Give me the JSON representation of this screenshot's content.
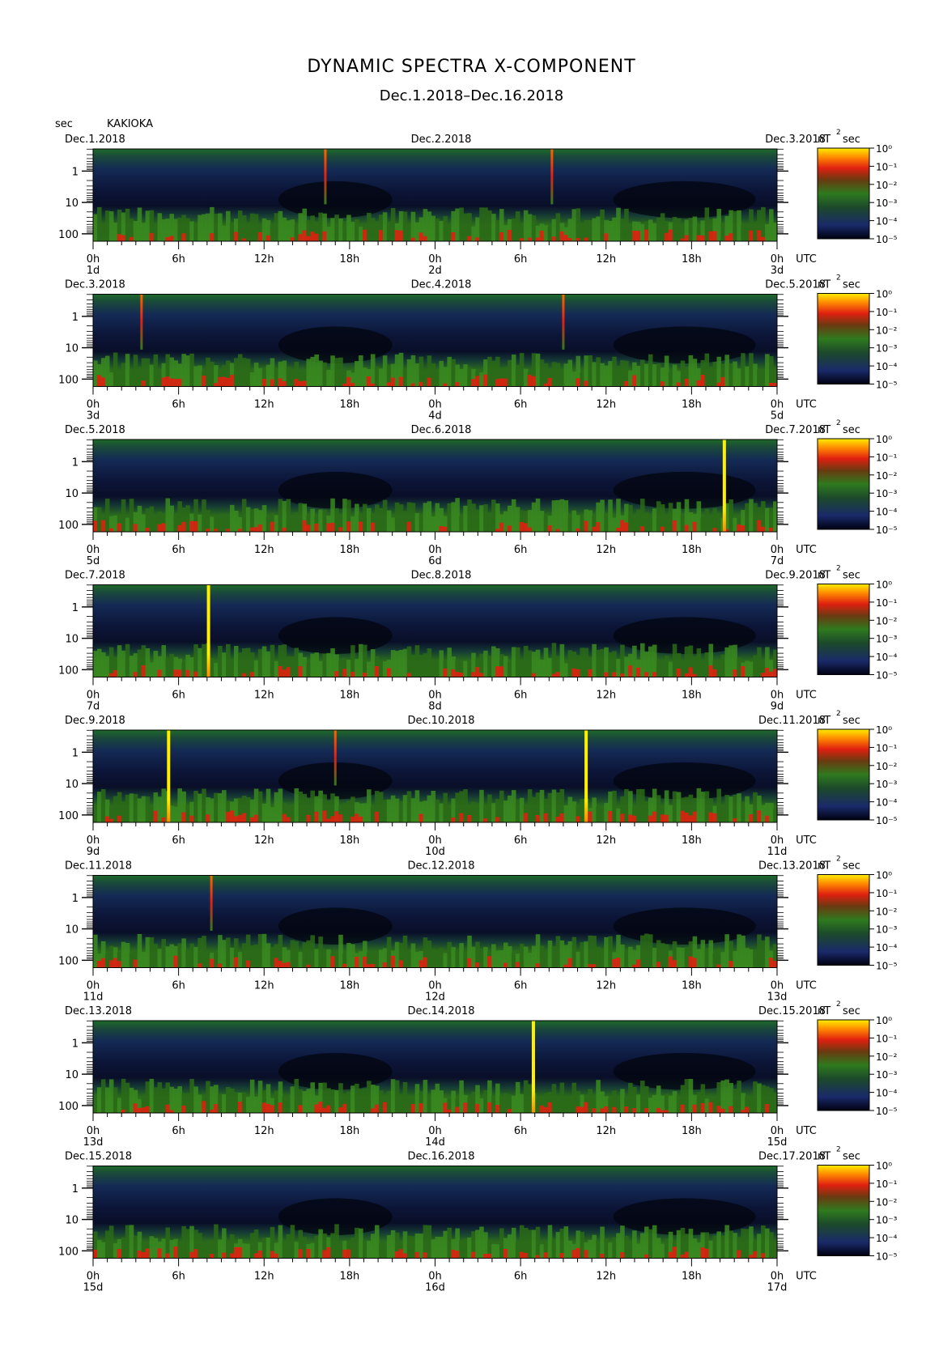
{
  "title": "DYNAMIC SPECTRA X-COMPONENT",
  "subtitle": "Dec.1.2018–Dec.16.2018",
  "y_unit": "sec",
  "station": "KAKIOKA",
  "colorbar_unit": "nT",
  "colorbar_unit_sup": "2",
  "colorbar_unit_sec": "sec",
  "colorbar_ticks": [
    "10⁰",
    "10⁻¹",
    "10⁻²",
    "10⁻³",
    "10⁻⁴",
    "10⁻⁵"
  ],
  "time_unit": "UTC",
  "colors": {
    "background_low": "#0a0a2a",
    "low": "#1a2a6a",
    "mid": "#2f7a1e",
    "high": "#e02010",
    "max": "#ffee00"
  },
  "chart_data": {
    "type": "heatmap",
    "xlabel": "",
    "ylabel": "sec",
    "y_ticks": [
      "1",
      "10",
      "100"
    ],
    "y_scale": "log",
    "x_ticks": [
      "0h",
      "6h",
      "12h",
      "18h",
      "0h",
      "6h",
      "12h",
      "18h",
      "0h"
    ],
    "colorbar": {
      "label": "nT²sec",
      "scale": "log",
      "range": [
        1e-05,
        1
      ]
    },
    "panels": [
      {
        "date_left": "Dec.1.2018",
        "date_mid": "Dec.2.2018",
        "date_right": "Dec.3.2018",
        "day_left": "1d",
        "day_mid": "2d",
        "day_right": "3d",
        "spikes": [
          {
            "hour": 16.3,
            "color": "red"
          },
          {
            "hour": 32.2,
            "color": "red"
          }
        ]
      },
      {
        "date_left": "Dec.3.2018",
        "date_mid": "Dec.4.2018",
        "date_right": "Dec.5.2018",
        "day_left": "3d",
        "day_mid": "4d",
        "day_right": "5d",
        "spikes": [
          {
            "hour": 3.4,
            "color": "red"
          },
          {
            "hour": 33.0,
            "color": "red"
          }
        ]
      },
      {
        "date_left": "Dec.5.2018",
        "date_mid": "Dec.6.2018",
        "date_right": "Dec.7.2018",
        "day_left": "5d",
        "day_mid": "6d",
        "day_right": "7d",
        "spikes": [
          {
            "hour": 44.3,
            "color": "yellow"
          }
        ]
      },
      {
        "date_left": "Dec.7.2018",
        "date_mid": "Dec.8.2018",
        "date_right": "Dec.9.2018",
        "day_left": "7d",
        "day_mid": "8d",
        "day_right": "9d",
        "spikes": [
          {
            "hour": 8.1,
            "color": "yellow"
          }
        ]
      },
      {
        "date_left": "Dec.9.2018",
        "date_mid": "Dec.10.2018",
        "date_right": "Dec.11.2018",
        "day_left": "9d",
        "day_mid": "10d",
        "day_right": "11d",
        "spikes": [
          {
            "hour": 5.3,
            "color": "yellow"
          },
          {
            "hour": 17.0,
            "color": "red"
          },
          {
            "hour": 34.6,
            "color": "yellow"
          }
        ]
      },
      {
        "date_left": "Dec.11.2018",
        "date_mid": "Dec.12.2018",
        "date_right": "Dec.13.2018",
        "day_left": "11d",
        "day_mid": "12d",
        "day_right": "13d",
        "spikes": [
          {
            "hour": 8.3,
            "color": "red"
          }
        ]
      },
      {
        "date_left": "Dec.13.2018",
        "date_mid": "Dec.14.2018",
        "date_right": "Dec.15.2018",
        "day_left": "13d",
        "day_mid": "14d",
        "day_right": "15d",
        "spikes": [
          {
            "hour": 30.9,
            "color": "yellow"
          }
        ]
      },
      {
        "date_left": "Dec.15.2018",
        "date_mid": "Dec.16.2018",
        "date_right": "Dec.17.2018",
        "day_left": "15d",
        "day_mid": "16d",
        "day_right": "17d",
        "spikes": []
      }
    ]
  }
}
